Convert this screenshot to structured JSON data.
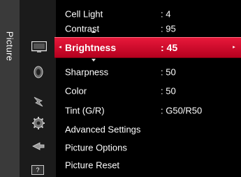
{
  "side_tab": {
    "label": "Picture"
  },
  "icons": [
    {
      "name": "picture-icon"
    },
    {
      "name": "sound-icon"
    },
    {
      "name": "channel-icon"
    },
    {
      "name": "setup-icon"
    },
    {
      "name": "input-icon"
    },
    {
      "name": "support-icon",
      "text": "?"
    }
  ],
  "menu": {
    "items": [
      {
        "label": "Cell Light",
        "value": ": 4"
      },
      {
        "label": "Contrast",
        "value": ": 95"
      },
      {
        "label": "Brightness",
        "value": ": 45"
      },
      {
        "label": "Sharpness",
        "value": ": 50"
      },
      {
        "label": "Color",
        "value": ": 50"
      },
      {
        "label": "Tint (G/R)",
        "value": ": G50/R50"
      },
      {
        "label": "Advanced Settings",
        "value": ""
      },
      {
        "label": "Picture Options",
        "value": ""
      },
      {
        "label": "Picture Reset",
        "value": ""
      }
    ],
    "selected_index": 2
  },
  "colors": {
    "highlight": "#d90f30",
    "background": "#000000",
    "side_tab": "#3a3a3a",
    "icon_column": "#1b1b1b"
  }
}
